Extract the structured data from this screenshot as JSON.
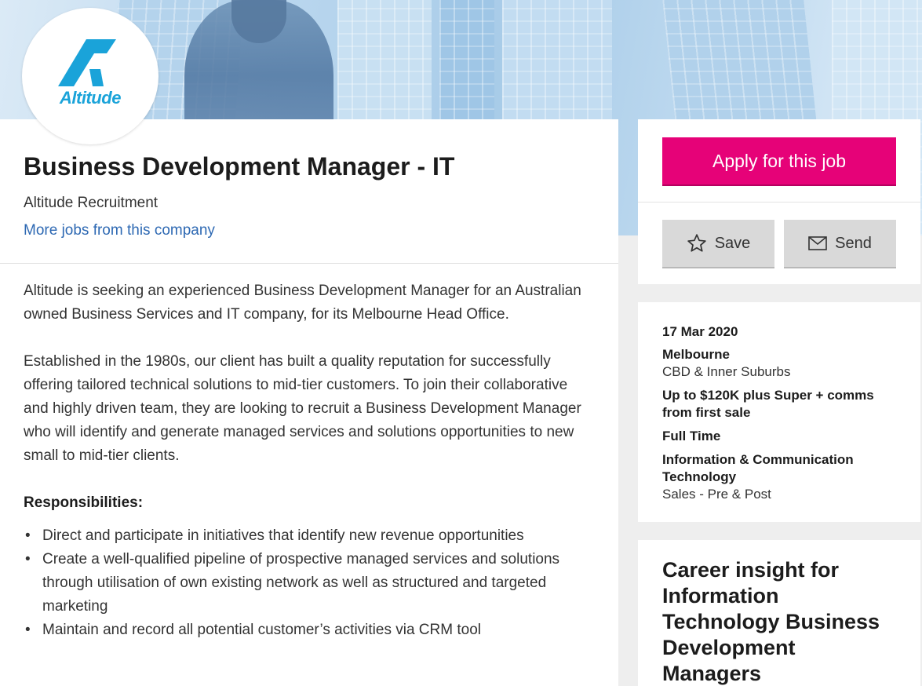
{
  "brand": {
    "logo_text": "Altitude",
    "logo_color": "#1aa3d9"
  },
  "job": {
    "title": "Business Development Manager - IT",
    "company": "Altitude Recruitment",
    "more_jobs_link": "More jobs from this company"
  },
  "description": {
    "paragraphs": [
      "Altitude is seeking an experienced Business Development Manager for an Australian owned Business Services and IT company, for its Melbourne Head Office.",
      "Established in the 1980s, our client has built a quality reputation for successfully offering tailored technical solutions to mid-tier customers. To join their collaborative and highly driven team, they are looking to recruit a Business Development Manager who will identify and generate managed services and solutions opportunities to new small to mid-tier clients."
    ],
    "responsibilities_heading": "Responsibilities:",
    "responsibilities": [
      "Direct and participate in initiatives that identify new revenue opportunities",
      "Create a well-qualified pipeline of prospective managed services and solutions through utilisation of own existing network as well as structured and targeted marketing",
      "Maintain and record all potential customer’s activities via CRM tool"
    ]
  },
  "actions": {
    "apply_label": "Apply for this job",
    "save_label": "Save",
    "send_label": "Send",
    "apply_color": "#e60278"
  },
  "details": {
    "date": "17 Mar 2020",
    "location": "Melbourne",
    "area": "CBD & Inner Suburbs",
    "salary": "Up to $120K plus Super + comms from first sale",
    "work_type": "Full Time",
    "classification": "Information & Communication Technology",
    "sub_classification": "Sales - Pre & Post"
  },
  "insight": {
    "title": "Career insight for Information Technology Business Development Managers"
  }
}
